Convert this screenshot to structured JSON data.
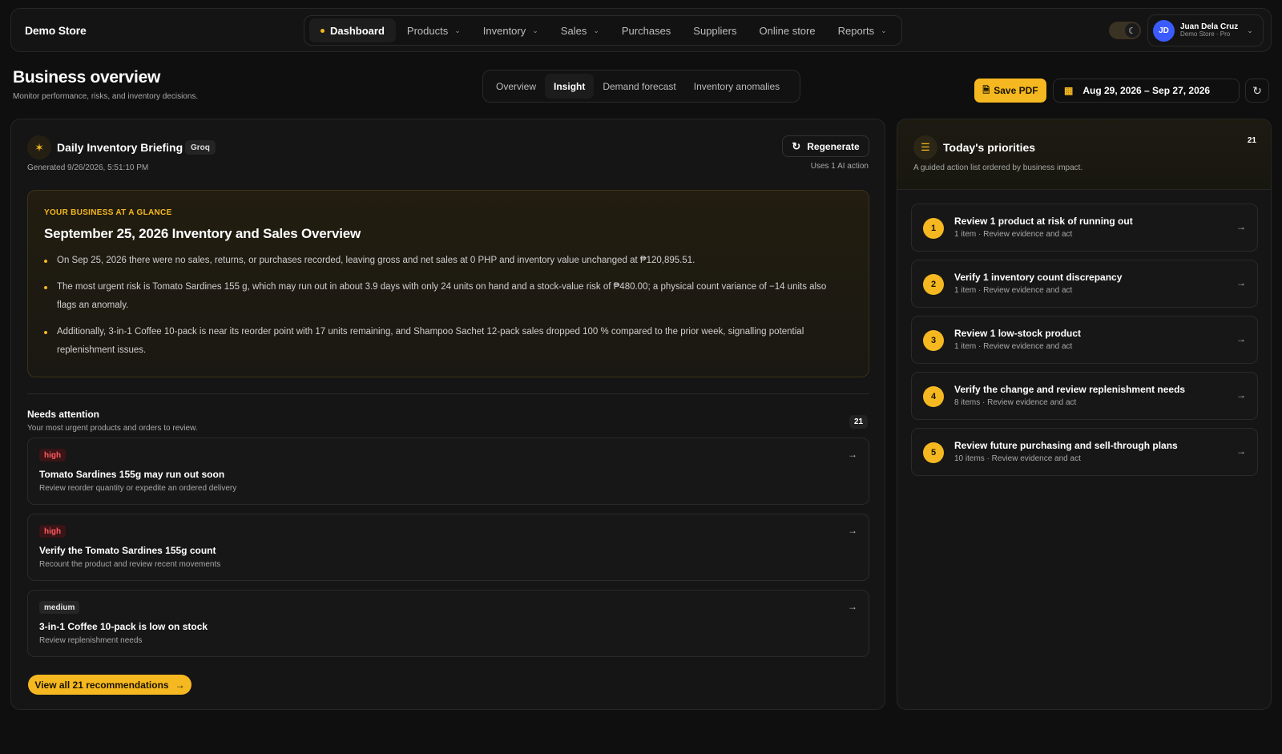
{
  "brand": "Demo Store",
  "nav": [
    {
      "label": "Dashboard",
      "active": true,
      "dropdown": false
    },
    {
      "label": "Products",
      "dropdown": true
    },
    {
      "label": "Inventory",
      "dropdown": true
    },
    {
      "label": "Sales",
      "dropdown": true
    },
    {
      "label": "Purchases",
      "dropdown": false
    },
    {
      "label": "Suppliers",
      "dropdown": false
    },
    {
      "label": "Online store",
      "dropdown": false
    },
    {
      "label": "Reports",
      "dropdown": true
    }
  ],
  "user": {
    "initials": "JD",
    "name": "Juan Dela Cruz",
    "plan": "Demo Store · Pro"
  },
  "page": {
    "title": "Business overview",
    "subtitle": "Monitor performance, risks, and inventory decisions."
  },
  "tabs": [
    {
      "label": "Overview"
    },
    {
      "label": "Insight",
      "active": true
    },
    {
      "label": "Demand forecast"
    },
    {
      "label": "Inventory anomalies"
    }
  ],
  "actions": {
    "save_pdf": "Save PDF",
    "date_range": "Aug 29, 2026 – Sep 27, 2026"
  },
  "briefing": {
    "title": "Daily Inventory Briefing",
    "badge": "Groq",
    "generated": "Generated 9/26/2026, 5:51:10 PM",
    "regenerate": "Regenerate",
    "ai_note": "Uses 1 AI action",
    "eyebrow": "YOUR BUSINESS AT A GLANCE",
    "headline": "September 25, 2026 Inventory and Sales Overview",
    "bullets": [
      "On Sep 25, 2026 there were no sales, returns, or purchases recorded, leaving gross and net sales at 0 PHP and inventory value unchanged at ₱120,895.51.",
      "The most urgent risk is Tomato Sardines 155 g, which may run out in about 3.9 days with only 24 units on hand and a stock-value risk of ₱480.00; a physical count variance of −14 units also flags an anomaly.",
      "Additionally, 3-in-1 Coffee 10-pack is near its reorder point with 17 units remaining, and Shampoo Sachet 12-pack sales dropped 100 % compared to the prior week, signalling potential replenishment issues."
    ]
  },
  "needs_attention": {
    "title": "Needs attention",
    "subtitle": "Your most urgent products and orders to review.",
    "count": "21",
    "items": [
      {
        "severity": "high",
        "title": "Tomato Sardines 155g may run out soon",
        "desc": "Review reorder quantity or expedite an ordered delivery"
      },
      {
        "severity": "high",
        "title": "Verify the Tomato Sardines 155g count",
        "desc": "Recount the product and review recent movements"
      },
      {
        "severity": "medium",
        "title": "3-in-1 Coffee 10-pack is low on stock",
        "desc": "Review replenishment needs"
      }
    ],
    "view_all": "View all 21 recommendations"
  },
  "priorities": {
    "title": "Today's priorities",
    "subtitle": "A guided action list ordered by business impact.",
    "count": "21",
    "items": [
      {
        "num": "1",
        "title": "Review 1 product at risk of running out",
        "desc": "1 item · Review evidence and act"
      },
      {
        "num": "2",
        "title": "Verify 1 inventory count discrepancy",
        "desc": "1 item · Review evidence and act"
      },
      {
        "num": "3",
        "title": "Review 1 low-stock product",
        "desc": "1 item · Review evidence and act"
      },
      {
        "num": "4",
        "title": "Verify the change and review replenishment needs",
        "desc": "8 items · Review evidence and act"
      },
      {
        "num": "5",
        "title": "Review future purchasing and sell-through plans",
        "desc": "10 items · Review evidence and act"
      }
    ]
  },
  "colors": {
    "accent": "#f5b820",
    "background": "#0f0f0f",
    "danger": "#ff5a5f"
  }
}
